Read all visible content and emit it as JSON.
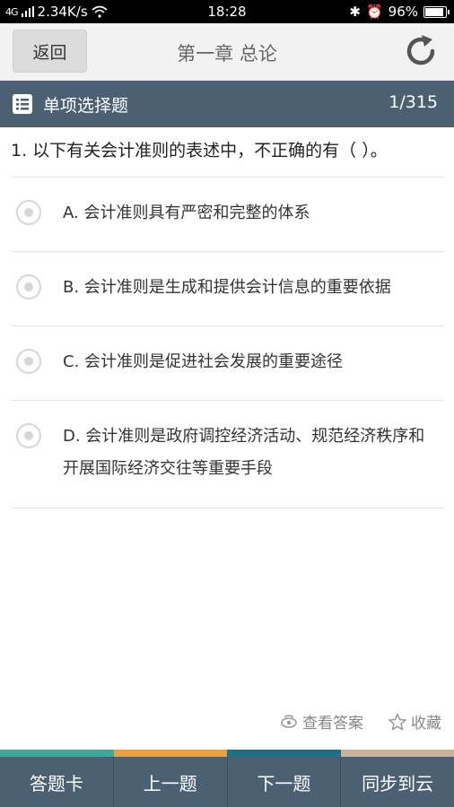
{
  "statusbar": {
    "signal": "4G",
    "speed": "2.34K/s",
    "time": "18:28",
    "battery": "96%",
    "battery_level": 0.96
  },
  "header": {
    "back_label": "返回",
    "title": "第一章 总论"
  },
  "typebar": {
    "label": "单项选择题",
    "progress": "1/315"
  },
  "question": {
    "text": "1. 以下有关会计准则的表述中，不正确的有（ ）。",
    "options": [
      {
        "label": "A. 会计准则具有严密和完整的体系"
      },
      {
        "label": "B. 会计准则是生成和提供会计信息的重要依据"
      },
      {
        "label": "C. 会计准则是促进社会发展的重要途径"
      },
      {
        "label": "D. 会计准则是政府调控经济活动、规范经济秩序和开展国际经济交往等重要手段"
      }
    ]
  },
  "actions": {
    "view_answer": "查看答案",
    "favorite": "收藏"
  },
  "stripe_colors": [
    "#3fa89b",
    "#e8a13c",
    "#1f6f86",
    "#c8b39a"
  ],
  "bottomnav": {
    "answer_card": "答题卡",
    "prev": "上一题",
    "next": "下一题",
    "sync": "同步到云"
  }
}
